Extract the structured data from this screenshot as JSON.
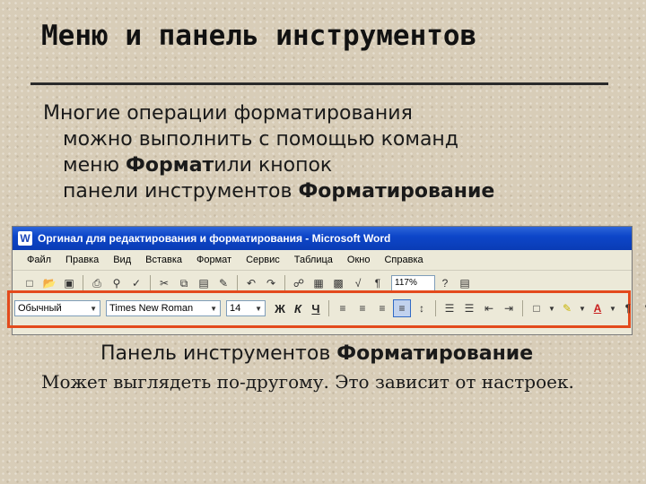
{
  "slide": {
    "title": "Меню и панель инструментов",
    "body": {
      "line1": "Многие операции форматирования",
      "line2": "можно выполнить с помощью команд",
      "line3_prefix": "меню ",
      "line3_bold": "Формат",
      "line3_suffix": "или кнопок",
      "line4_prefix": "панели инструментов ",
      "line4_bold": "Форматирование"
    },
    "caption_prefix": "Панель инструментов ",
    "caption_bold": "Форматирование",
    "note": "Может выглядеть по-другому. Это зависит от настроек."
  },
  "word": {
    "window_title": "Оргинал для редактирования и форматирования - Microsoft Word",
    "app_icon_letter": "W",
    "menu": [
      "Файл",
      "Правка",
      "Вид",
      "Вставка",
      "Формат",
      "Сервис",
      "Таблица",
      "Окно",
      "Справка"
    ],
    "zoom": "117%",
    "style_value": "Обычный",
    "font_value": "Times New Roman",
    "size_value": "14",
    "bold_label": "Ж",
    "italic_label": "К",
    "underline_label": "Ч",
    "highlight_color": "#e34a1c",
    "title_bar_color": "#0d46c9"
  }
}
